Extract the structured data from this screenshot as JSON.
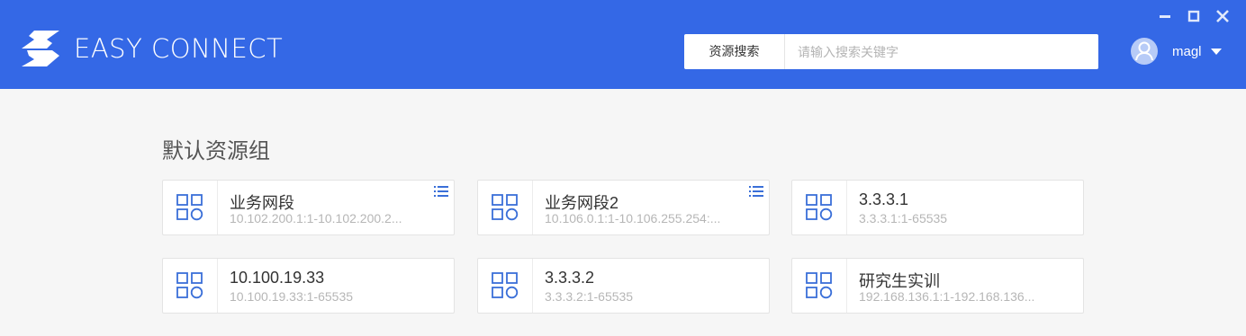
{
  "app": {
    "logo_text": "EASY CONNECT"
  },
  "search": {
    "label": "资源搜索",
    "placeholder": "请输入搜索关键字",
    "value": ""
  },
  "user": {
    "name": "magl"
  },
  "group": {
    "title": "默认资源组"
  },
  "resources": [
    {
      "name": "业务网段",
      "range": "10.102.200.1:1-10.102.200.2...",
      "has_menu": true
    },
    {
      "name": "业务网段2",
      "range": "10.106.0.1:1-10.106.255.254:...",
      "has_menu": true
    },
    {
      "name": "3.3.3.1",
      "range": "3.3.3.1:1-65535",
      "has_menu": false
    },
    {
      "name": "10.100.19.33",
      "range": "10.100.19.33:1-65535",
      "has_menu": false
    },
    {
      "name": "3.3.3.2",
      "range": "3.3.3.2:1-65535",
      "has_menu": false
    },
    {
      "name": "研究生实训",
      "range": "192.168.136.1:1-192.168.136...",
      "has_menu": false
    }
  ],
  "colors": {
    "header_bg": "#3468e6",
    "page_bg": "#f6f6f6",
    "resource_icon": "#3a6fd8"
  },
  "icons": {
    "logo": "easyconnect-logo-icon",
    "minimize": "minimize-icon",
    "maximize": "maximize-icon",
    "close": "close-icon",
    "avatar": "user-avatar-icon",
    "caret": "chevron-down-icon",
    "resource": "app-grid-icon",
    "menu": "list-menu-icon"
  }
}
